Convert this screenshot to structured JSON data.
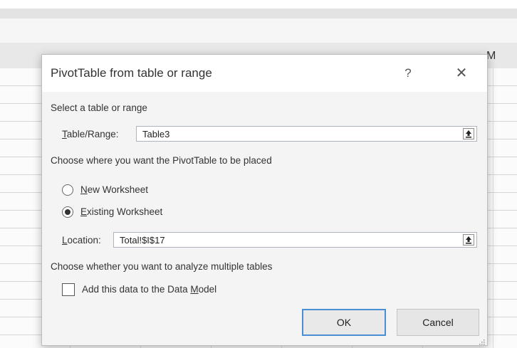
{
  "spreadsheet": {
    "column_header_letter": "M"
  },
  "dialog": {
    "title": "PivotTable from table or range",
    "help_label": "?",
    "close_label": "✕",
    "select_section_label": "Select a table or range",
    "table_range": {
      "label_access": "T",
      "label_rest": "able/Range:",
      "value": "Table3"
    },
    "placement_section_label": "Choose where you want the PivotTable to be placed",
    "options": {
      "new_worksheet": {
        "access": "N",
        "rest": "ew Worksheet",
        "selected": false
      },
      "existing_worksheet": {
        "access": "E",
        "rest": "xisting Worksheet",
        "selected": true
      }
    },
    "location": {
      "label_access": "L",
      "label_rest": "ocation:",
      "value": "Total!$I$17"
    },
    "multiple_tables_section_label": "Choose whether you want to analyze multiple tables",
    "data_model": {
      "label_before": "Add this data to the Data ",
      "label_access": "M",
      "label_after": "odel",
      "checked": false
    },
    "ok_label": "OK",
    "cancel_label": "Cancel"
  },
  "icons": {
    "collapse": "collapse-dialog-icon",
    "resize": "resize-grip-icon"
  }
}
